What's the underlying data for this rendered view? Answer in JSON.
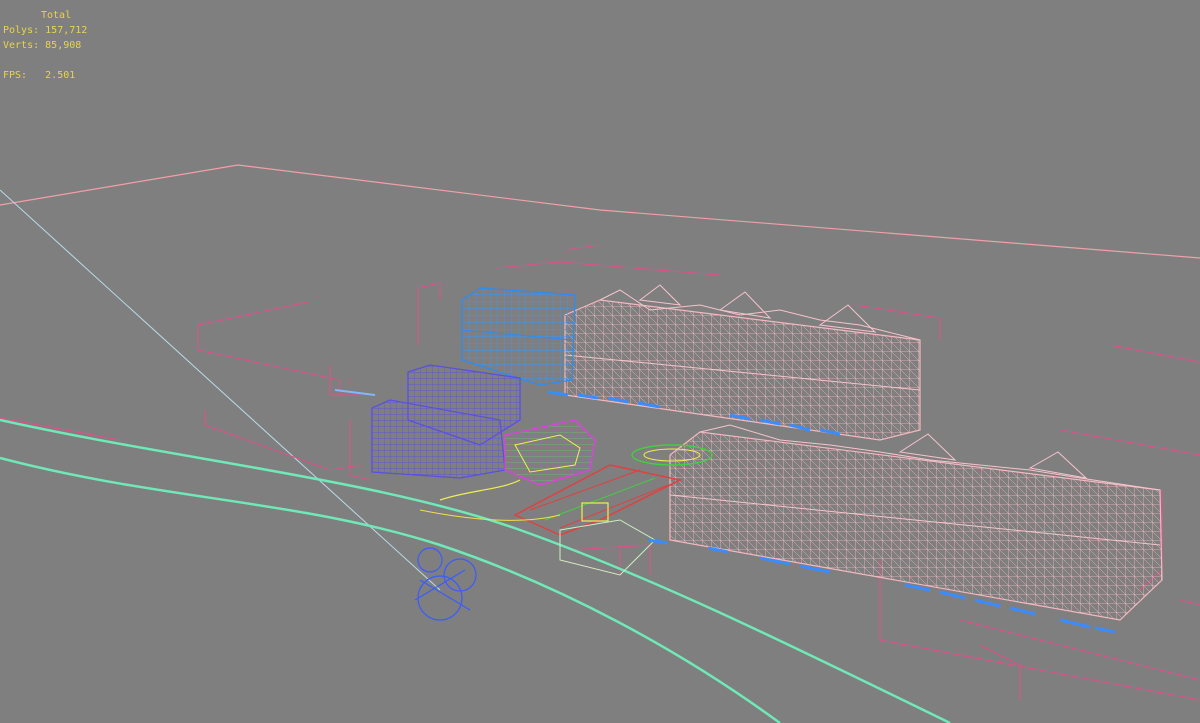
{
  "viewport": {
    "background": "#7f7f7f",
    "stats": {
      "title": "Total",
      "polys_label": "Polys:",
      "polys_value": "157,712",
      "verts_label": "Verts:",
      "verts_value": "85,908",
      "fps_label": "FPS:",
      "fps_value": "2.501",
      "color": "#e8d44a"
    }
  },
  "colors": {
    "ground_outline": "#f0a0a8",
    "bbox": "#e0508a",
    "building_pink": "#f3b8c0",
    "building_blue": "#2e8cf0",
    "building_violet": "#5a50e0",
    "road": "#70e8b8",
    "camera_line": "#b8dcea",
    "windows": "#3a8cff",
    "yellow": "#f0f050",
    "red": "#e04040",
    "green": "#40d040"
  }
}
